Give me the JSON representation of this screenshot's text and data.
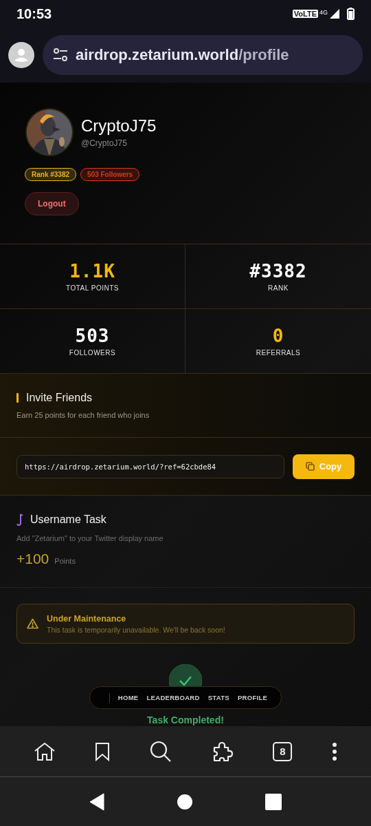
{
  "status_bar": {
    "time": "10:53",
    "network": "VoLTE",
    "generation": "4G"
  },
  "address_bar": {
    "domain": "airdrop.zetarium.world",
    "path": "/profile"
  },
  "profile": {
    "name": "CryptoJ75",
    "handle": "@CryptoJ75",
    "badges": [
      {
        "label": "Rank #3382",
        "color": "#e6b422"
      },
      {
        "label": "503 Followers",
        "color": "#d9381e"
      }
    ],
    "logout": "Logout"
  },
  "stats": [
    {
      "value": "1.1K",
      "label": "TOTAL POINTS",
      "color": "#f5b80e"
    },
    {
      "value": "#3382",
      "label": "RANK",
      "color": "#ffffff"
    },
    {
      "value": "503",
      "label": "FOLLOWERS",
      "color": "#ffffff"
    },
    {
      "value": "0",
      "label": "REFERRALS",
      "color": "#f5b80e"
    }
  ],
  "invite": {
    "title": "Invite Friends",
    "subtitle": "Earn 25 points for each friend who joins",
    "link": "https://airdrop.zetarium.world/?ref=62cbde84",
    "copy": "Copy"
  },
  "task": {
    "title": "Username Task",
    "description": "Add \"Zetarium\" to your Twitter display name",
    "reward": "+100",
    "reward_unit": "Points"
  },
  "notice": {
    "title": "Under Maintenance",
    "message": "This task is temporarily unavailable. We'll be back soon!"
  },
  "completed": {
    "title": "Task Completed!"
  },
  "site_nav": [
    "HOME",
    "LEADERBOARD",
    "STATS",
    "PROFILE"
  ],
  "browser_toolbar": {
    "tab_count": "8"
  }
}
